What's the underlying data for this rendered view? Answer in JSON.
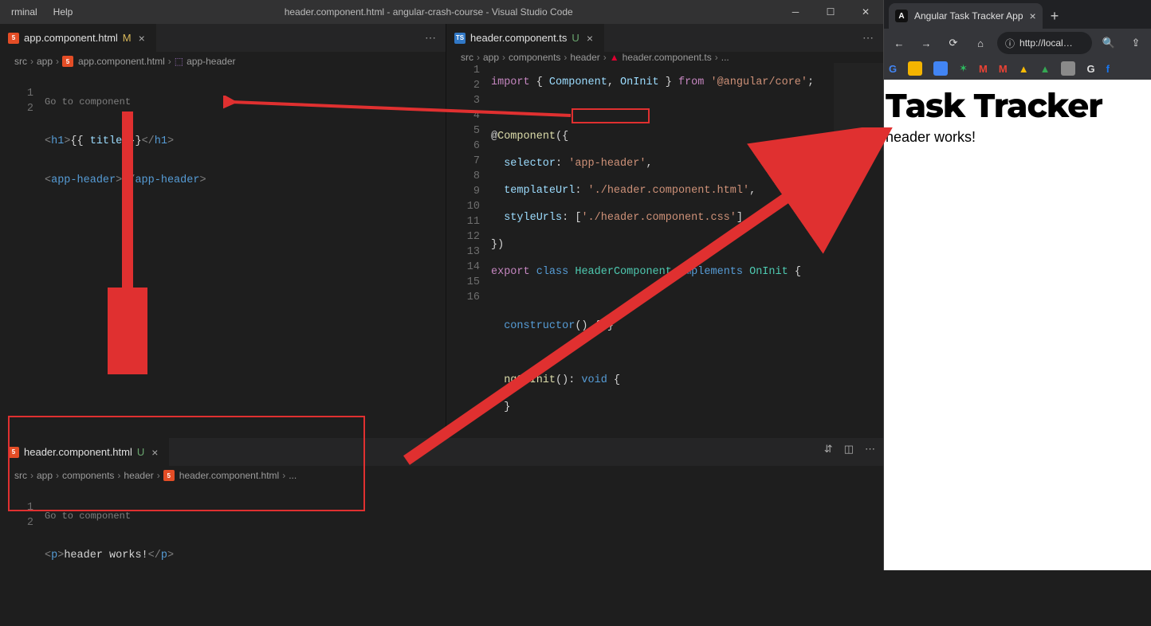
{
  "vscode": {
    "menu": [
      "rminal",
      "Help"
    ],
    "title": "header.component.html - angular-crash-course - Visual Studio Code",
    "left": {
      "tab": {
        "file": "app.component.html",
        "badge": "M"
      },
      "breadcrumb": [
        "src",
        "app",
        "app.component.html",
        "app-header"
      ],
      "hint": "Go to component",
      "code": {
        "l1": {
          "a": "<",
          "b": "h1",
          "c": ">",
          "d": "{{ ",
          "e": "title",
          "f": " }}",
          "g": "</",
          "h": "h1",
          "i": ">"
        },
        "l2": {
          "a": "<",
          "b": "app-header",
          "c": ">",
          "d": "</",
          "e": "app-header",
          "f": ">"
        }
      }
    },
    "right": {
      "tab": {
        "file": "header.component.ts",
        "badge": "U"
      },
      "breadcrumb": [
        "src",
        "app",
        "components",
        "header",
        "header.component.ts",
        "..."
      ],
      "code": {
        "l1": {
          "a": "import",
          "b": " { ",
          "c": "Component",
          "d": ", ",
          "e": "OnInit",
          "f": " } ",
          "g": "from",
          "h": " ",
          "i": "'@angular/core'",
          "j": ";"
        },
        "l3": {
          "a": "@",
          "b": "Component",
          "c": "({"
        },
        "l4": {
          "a": "  ",
          "b": "selector",
          "c": ": ",
          "d": "'app-header'",
          "e": ","
        },
        "l5": {
          "a": "  ",
          "b": "templateUrl",
          "c": ": ",
          "d": "'./header.component.html'",
          "e": ","
        },
        "l6": {
          "a": "  ",
          "b": "styleUrls",
          "c": ": [",
          "d": "'./header.component.css'",
          "e": "]"
        },
        "l7": "})",
        "l8": {
          "a": "export",
          "b": " ",
          "c": "class",
          "d": " ",
          "e": "HeaderComponent",
          "f": " ",
          "g": "implements",
          "h": " ",
          "i": "OnInit",
          "j": " {"
        },
        "l10": {
          "a": "  ",
          "b": "constructor",
          "c": "() { }"
        },
        "l12": {
          "a": "  ",
          "b": "ngOnInit",
          "c": "(): ",
          "d": "void",
          "e": " {"
        },
        "l13": "  }",
        "l15": "}"
      }
    },
    "bottom": {
      "tab": {
        "file": "header.component.html",
        "badge": "U"
      },
      "breadcrumb": [
        "src",
        "app",
        "components",
        "header",
        "header.component.html",
        "..."
      ],
      "hint": "Go to component",
      "code": {
        "l1": {
          "a": "<",
          "b": "p",
          "c": ">",
          "d": "header works!",
          "e": "</",
          "f": "p",
          "g": ">"
        }
      }
    }
  },
  "browser": {
    "tab_title": "Angular Task Tracker App",
    "address": "http://local…",
    "bookmarks": [
      {
        "name": "google",
        "color": "#fff"
      },
      {
        "name": "keep",
        "color": "#f4b400"
      },
      {
        "name": "calendar",
        "color": "#4285f4"
      },
      {
        "name": "evernote",
        "color": "#2dbe60"
      },
      {
        "name": "gmail-1",
        "color": "#ea4335"
      },
      {
        "name": "gmail-2",
        "color": "#ea4335"
      },
      {
        "name": "drive-1",
        "color": "#fbbc04"
      },
      {
        "name": "drive-2",
        "color": "#fbbc04"
      },
      {
        "name": "folder",
        "color": "#888"
      },
      {
        "name": "g-bookmark",
        "color": "#fff"
      },
      {
        "name": "facebook",
        "color": "#1877f2"
      }
    ],
    "page": {
      "heading": "Task Tracker",
      "text": "header works!"
    }
  }
}
